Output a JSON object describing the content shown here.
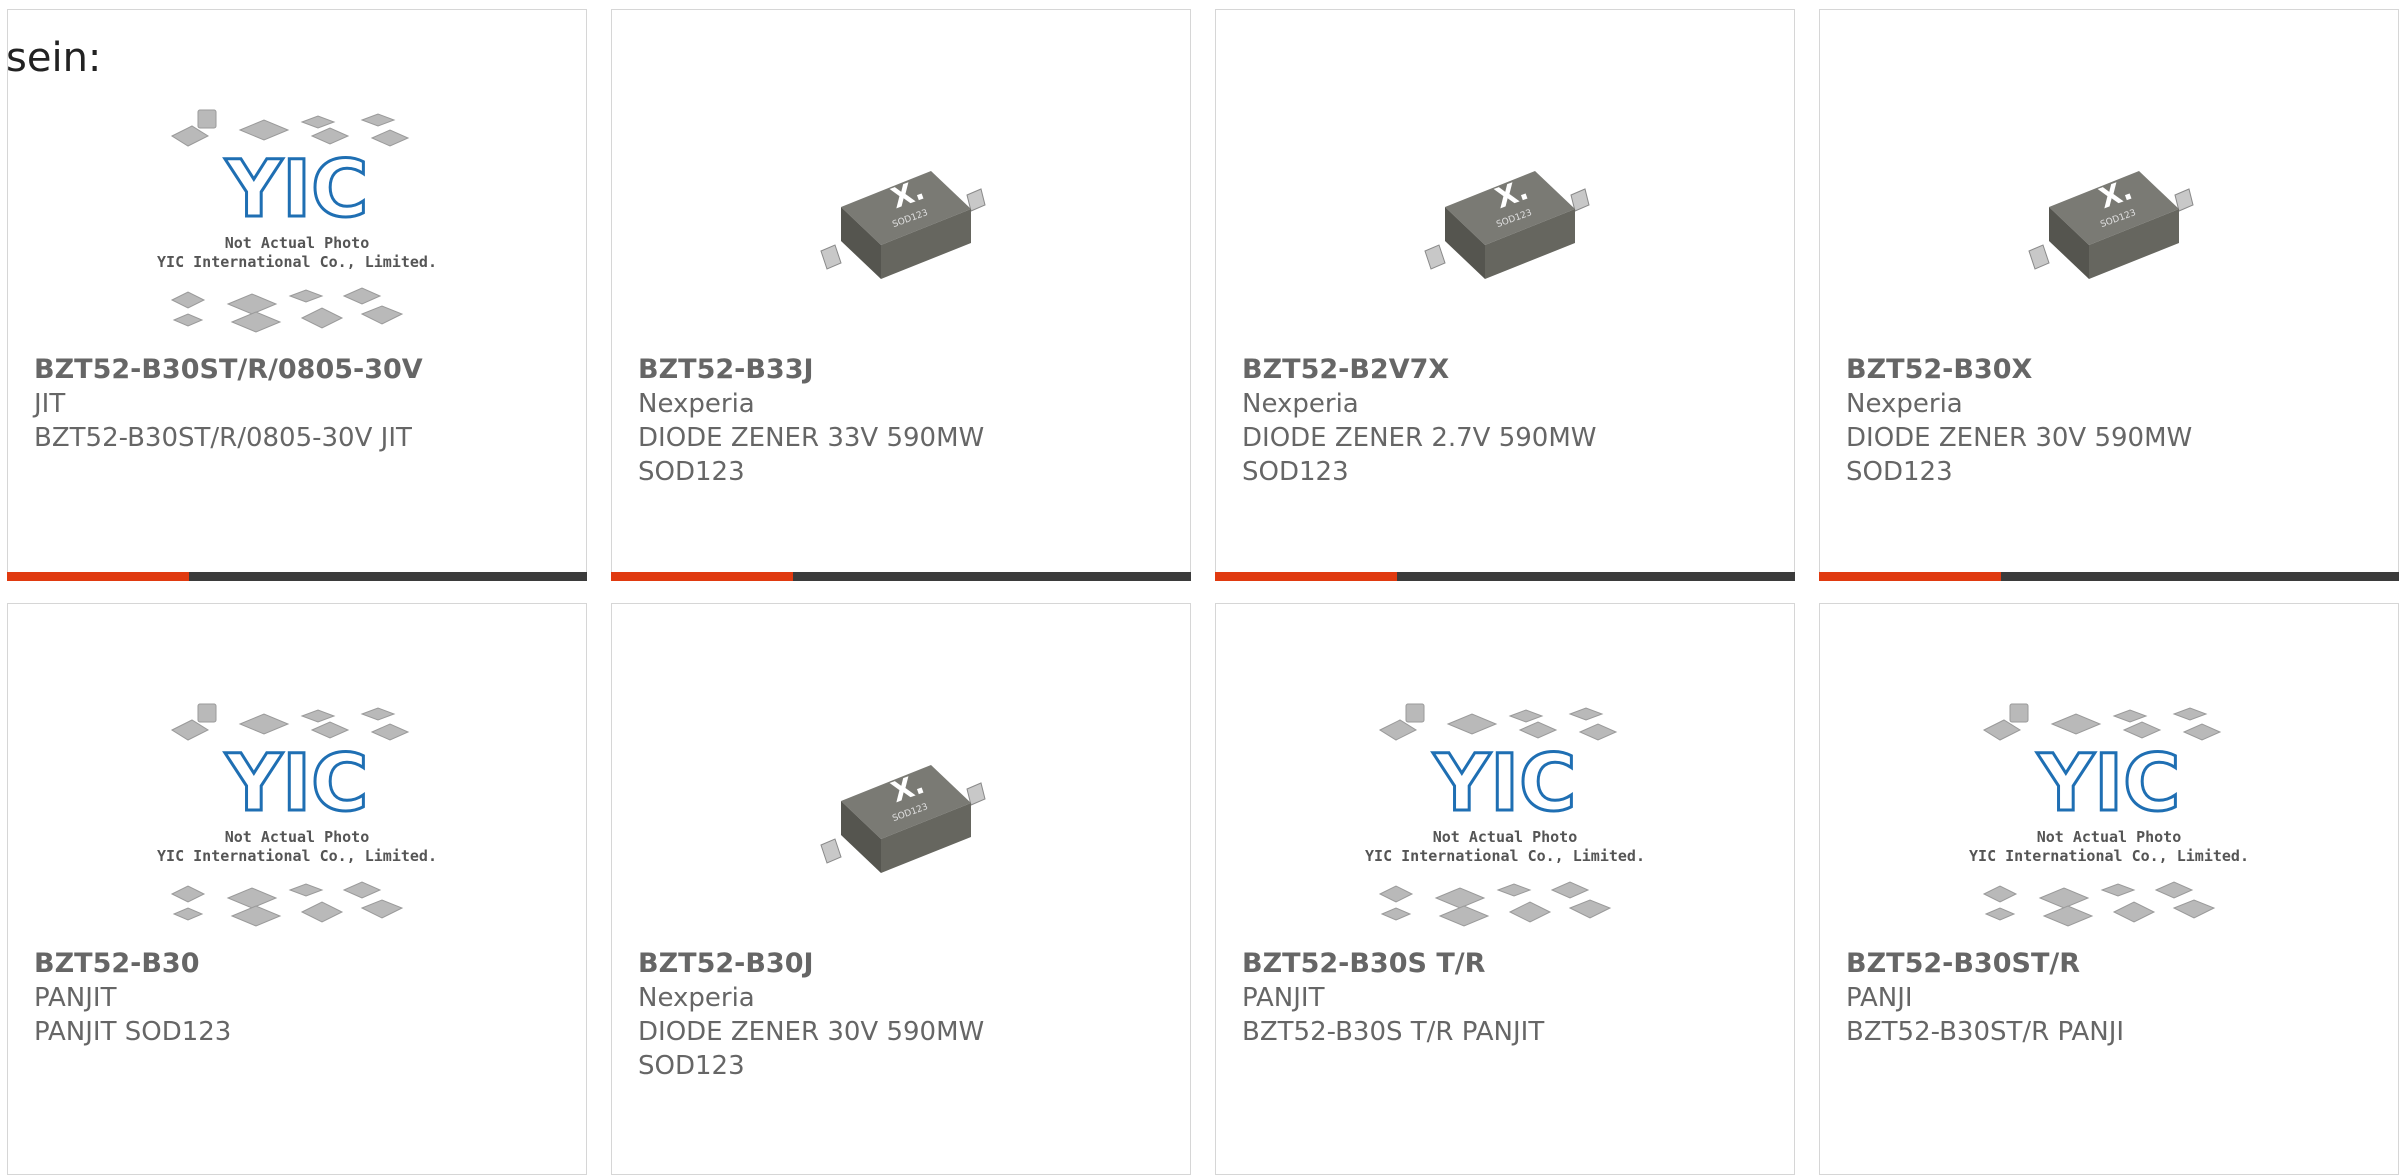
{
  "intro_text": "sein:",
  "placeholder_image": {
    "line1": "Not Actual Photo",
    "line2": "YIC International Co., Limited.",
    "logo_text": "YIC"
  },
  "chip_image": {
    "logo_text": "X.",
    "package_text": "SOD123"
  },
  "products": [
    {
      "part": "BZT52-B30ST/R/0805-30V",
      "manufacturer": "JIT",
      "desc1": "BZT52-B30ST/R/0805-30V JIT",
      "desc2": "",
      "image": "placeholder"
    },
    {
      "part": "BZT52-B33J",
      "manufacturer": "Nexperia",
      "desc1": "DIODE ZENER 33V 590MW",
      "desc2": "SOD123",
      "image": "chip"
    },
    {
      "part": "BZT52-B2V7X",
      "manufacturer": "Nexperia",
      "desc1": "DIODE ZENER 2.7V 590MW",
      "desc2": "SOD123",
      "image": "chip"
    },
    {
      "part": "BZT52-B30X",
      "manufacturer": "Nexperia",
      "desc1": "DIODE ZENER 30V 590MW",
      "desc2": "SOD123",
      "image": "chip"
    },
    {
      "part": "BZT52-B30",
      "manufacturer": "PANJIT",
      "desc1": "PANJIT SOD123",
      "desc2": "",
      "image": "placeholder"
    },
    {
      "part": "BZT52-B30J",
      "manufacturer": "Nexperia",
      "desc1": "DIODE ZENER 30V 590MW",
      "desc2": "SOD123",
      "image": "chip"
    },
    {
      "part": "BZT52-B30S T/R",
      "manufacturer": "PANJIT",
      "desc1": "BZT52-B30S T/R PANJIT",
      "desc2": "",
      "image": "placeholder"
    },
    {
      "part": "BZT52-B30ST/R",
      "manufacturer": "PANJI",
      "desc1": "BZT52-B30ST/R PANJI",
      "desc2": "",
      "image": "placeholder"
    }
  ],
  "colors": {
    "accent": "#e03a10",
    "bar": "#3b3b3b",
    "border": "#d6d6d6",
    "logo_blue": "#1f6fb3"
  }
}
